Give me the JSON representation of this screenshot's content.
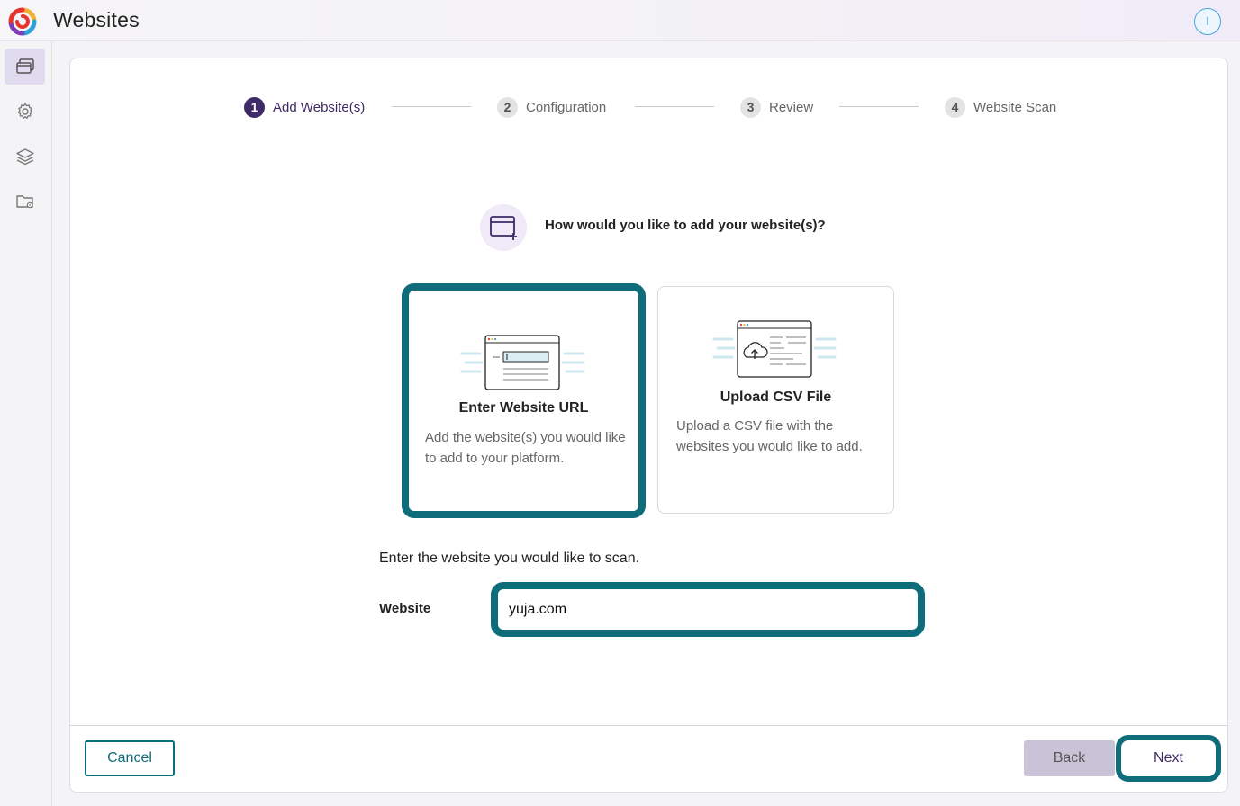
{
  "header": {
    "title": "Websites",
    "avatar_initial": "I"
  },
  "sidebar": {
    "items": [
      {
        "name": "websites",
        "icon": "windows-icon",
        "active": true
      },
      {
        "name": "settings",
        "icon": "gear-icon",
        "active": false
      },
      {
        "name": "layers",
        "icon": "layers-icon",
        "active": false
      },
      {
        "name": "folder-settings",
        "icon": "folder-gear-icon",
        "active": false
      }
    ]
  },
  "stepper": {
    "steps": [
      {
        "num": "1",
        "label": "Add Website(s)",
        "active": true
      },
      {
        "num": "2",
        "label": "Configuration",
        "active": false
      },
      {
        "num": "3",
        "label": "Review",
        "active": false
      },
      {
        "num": "4",
        "label": "Website Scan",
        "active": false
      }
    ]
  },
  "question": "How would you like to add your website(s)?",
  "options": [
    {
      "title": "Enter Website URL",
      "description": "Add the website(s) you would like to add to your platform.",
      "selected": true
    },
    {
      "title": "Upload CSV File",
      "description": "Upload a CSV file with the websites you would like to add.",
      "selected": false
    }
  ],
  "form": {
    "prompt": "Enter the website you would like to scan.",
    "website_label": "Website",
    "website_value": "yuja.com"
  },
  "footer": {
    "cancel_label": "Cancel",
    "back_label": "Back",
    "next_label": "Next"
  },
  "colors": {
    "accent": "#0f6c7a",
    "brand": "#3d2a66"
  }
}
